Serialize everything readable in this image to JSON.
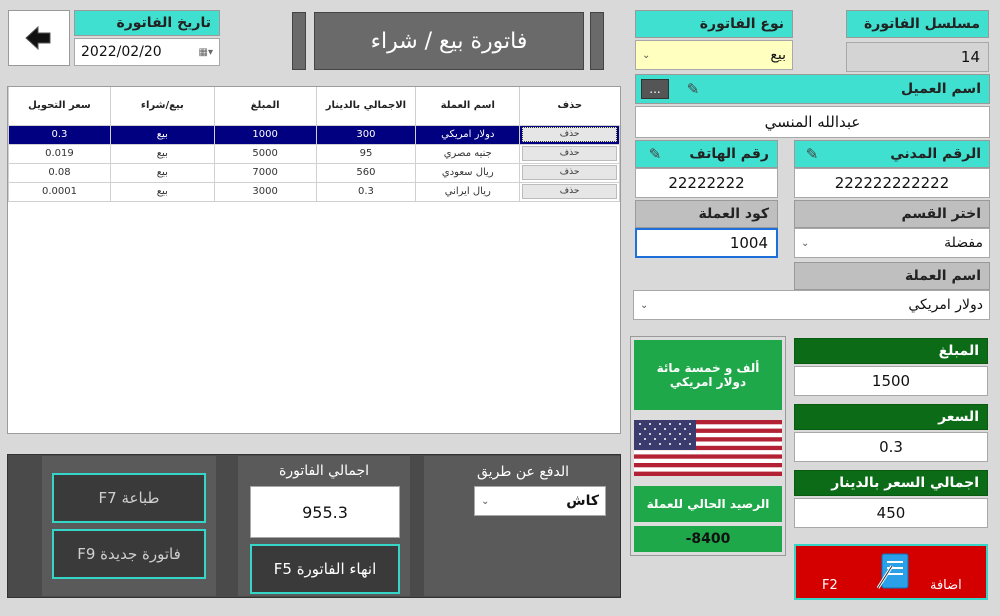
{
  "header": {
    "title": "فاتورة بيع / شراء",
    "date_label": "تاريخ الفاتورة",
    "date_value": "2022/02/20"
  },
  "invoice": {
    "serial_label": "مسلسل الفاتورة",
    "serial_value": "14",
    "type_label": "نوع الفاتورة",
    "type_value": "بيع"
  },
  "customer": {
    "name_label": "اسم العميل",
    "browse_label": "...",
    "name_value": "عبدالله المنسي",
    "phone_label": "رقم الهاتف",
    "phone_value": "22222222",
    "civil_label": "الرقم المدني",
    "civil_value": "222222222222"
  },
  "currency": {
    "code_label": "كود العملة",
    "code_value": "1004",
    "section_label": "اختر القسم",
    "section_value": "مفضلة",
    "name_label": "اسم العملة",
    "name_value": "دولار امريكي"
  },
  "amounts": {
    "amount_label": "المبلغ",
    "amount_value": "1500",
    "rate_label": "السعر",
    "rate_value": "0.3",
    "total_label": "اجمالي السعر بالدينار",
    "total_value": "450",
    "in_words": "ألف و خمسة مائة دولار امريكي",
    "balance_label": "الرصيد الحالي للعملة",
    "balance_value": "-8400"
  },
  "add_button": {
    "label": "اضافة",
    "shortcut": "F2"
  },
  "table": {
    "headers": [
      "حذف",
      "اسم العملة",
      "الاجمالي بالدينار",
      "المبلغ",
      "بيع/شراء",
      "سعر التحويل"
    ],
    "delete_label": "حذف",
    "rows": [
      {
        "currency": "دولار امريكي",
        "total": "300",
        "amount": "1000",
        "type": "بيع",
        "rate": "0.3"
      },
      {
        "currency": "جنيه مصري",
        "total": "95",
        "amount": "5000",
        "type": "بيع",
        "rate": "0.019"
      },
      {
        "currency": "ريال سعودي",
        "total": "560",
        "amount": "7000",
        "type": "بيع",
        "rate": "0.08"
      },
      {
        "currency": "ريال ايراني",
        "total": "0.3",
        "amount": "3000",
        "type": "بيع",
        "rate": "0.0001"
      }
    ]
  },
  "footer": {
    "payment_label": "الدفع عن طريق",
    "payment_value": "كاش",
    "invoice_total_label": "اجمالي الفاتورة",
    "invoice_total_value": "955.3",
    "finish_button": "انهاء الفاتورة F5",
    "print_button": "طباعة  F7",
    "new_button": "فاتورة جديدة  F9"
  },
  "colors": {
    "teal": "#40e0d0",
    "green": "#0b6b16",
    "selection": "#000080",
    "add_red": "#d40000",
    "dark_panel": "#4a4a4a"
  }
}
